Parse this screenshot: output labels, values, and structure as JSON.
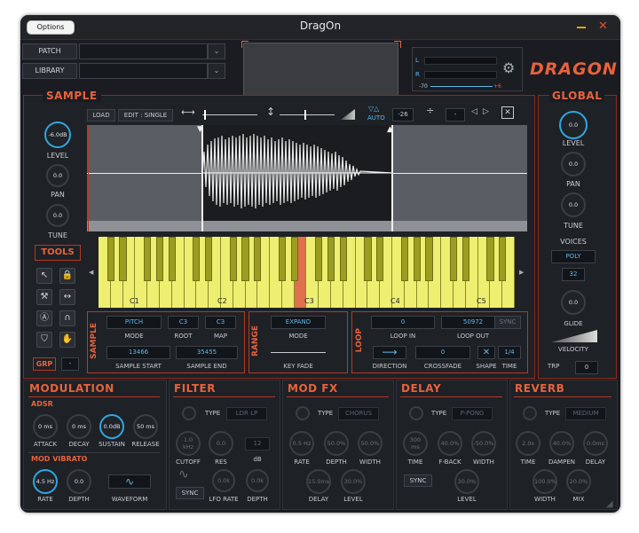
{
  "titlebar": {
    "options": "Options",
    "title": "DragOn"
  },
  "top": {
    "patch": "PATCH",
    "library": "LIBRARY",
    "meter_l": "L",
    "meter_r": "R",
    "meter_min": "-70",
    "meter_max": "+6",
    "logo": "DRAGON"
  },
  "sample": {
    "title": "SAMPLE",
    "load": "LOAD",
    "edit": "EDIT : SINGLE",
    "auto": "AUTO",
    "auto_value": "-26",
    "dash": "-",
    "level_value": "-6.0dB",
    "level": "LEVEL",
    "pan_value": "0.0",
    "pan": "PAN",
    "tune_value": "0.0",
    "tune": "TUNE"
  },
  "keyboard": {
    "c1": "C1",
    "c2": "C2",
    "c3": "C3",
    "c4": "C4",
    "c5": "C5"
  },
  "tools": {
    "title": "TOOLS",
    "grp": "GRP",
    "grp_value": "-"
  },
  "sample_section": {
    "label": "SAMPLE",
    "mode_value": "PITCH",
    "mode": "MODE",
    "root_value": "C3",
    "root": "ROOT",
    "map_value": "C3",
    "map": "MAP",
    "start_value": "13466",
    "start": "SAMPLE START",
    "end_value": "35455",
    "end": "SAMPLE END"
  },
  "range": {
    "label": "RANGE",
    "mode_value": "EXPAND",
    "mode": "MODE",
    "keyfade": "KEY FADE"
  },
  "loop": {
    "label": "LOOP",
    "in_value": "0",
    "in": "LOOP IN",
    "out_value": "50972",
    "out": "LOOP OUT",
    "sync": "SYNC",
    "direction": "DIRECTION",
    "crossfade_value": "0",
    "crossfade": "CROSSFADE",
    "shape": "SHAPE",
    "time_value": "1/4",
    "time": "TIME"
  },
  "global": {
    "title": "GLOBAL",
    "level_value": "0.0",
    "level": "LEVEL",
    "pan_value": "0.0",
    "pan": "PAN",
    "tune_value": "0.0",
    "tune": "TUNE",
    "voices": "VOICES",
    "poly": "POLY",
    "voices_value": "32",
    "glide_value": "0.0",
    "glide": "GLIDE",
    "velocity": "VELOCITY",
    "trp": "TRP",
    "trp_value": "0"
  },
  "modulation": {
    "title": "MODULATION",
    "adsr": "ADSR",
    "attack_value": "0 ms",
    "attack": "ATTACK",
    "decay_value": "0 ms",
    "decay": "DECAY",
    "sustain_value": "0.0dB",
    "sustain": "SUSTAIN",
    "release_value": "50 ms",
    "release": "RELEASE",
    "vibrato": "MOD VIBRATO",
    "rate_value": "4.5 Hz",
    "rate": "RATE",
    "depth_value": "0.0",
    "depth": "DEPTH",
    "waveform": "WAVEFORM"
  },
  "filter": {
    "title": "FILTER",
    "type": "TYPE",
    "type_value": "LDR LP",
    "cutoff_value": "1.0 kHz",
    "cutoff": "CUTOFF",
    "res_value": "0.0",
    "res": "RES",
    "db_value": "12",
    "db": "dB",
    "sync": "SYNC",
    "lfo_value": "0.0k",
    "lfo": "LFO RATE",
    "depth_value": "0.0k",
    "depth": "DEPTH"
  },
  "modfx": {
    "title": "MOD FX",
    "type": "TYPE",
    "type_value": "CHORUS",
    "rate_value": "0.5 Hz",
    "rate": "RATE",
    "depth_value": "50.0%",
    "depth": "DEPTH",
    "width_value": "50.0%",
    "width": "WIDTH",
    "delay_value": "15.0ms",
    "delay": "DELAY",
    "level_value": "30.0%",
    "level": "LEVEL"
  },
  "delay": {
    "title": "DELAY",
    "type": "TYPE",
    "type_value": "P-PONG",
    "time_value": "300 ms",
    "time": "TIME",
    "fback_value": "40.0%",
    "fback": "F-BACK",
    "width_value": "-50.0%",
    "width": "WIDTH",
    "sync": "SYNC",
    "level_value": "30.0%",
    "level": "LEVEL"
  },
  "reverb": {
    "title": "REVERB",
    "type": "TYPE",
    "type_value": "MEDIUM",
    "time_value": "2.0s",
    "time": "TIME",
    "dampen_value": "40.0%",
    "dampen": "DAMPEN",
    "delay_value": "0.0ms",
    "delay": "DELAY",
    "width_value": "100.0%",
    "width": "WIDTH",
    "mix_value": "20.0%",
    "mix": "MIX"
  },
  "colors": {
    "accent_orange": "#e8623c",
    "accent_blue": "#2ea7e0",
    "key_yellow": "#eeee70",
    "key_highlight": "#e07050"
  }
}
